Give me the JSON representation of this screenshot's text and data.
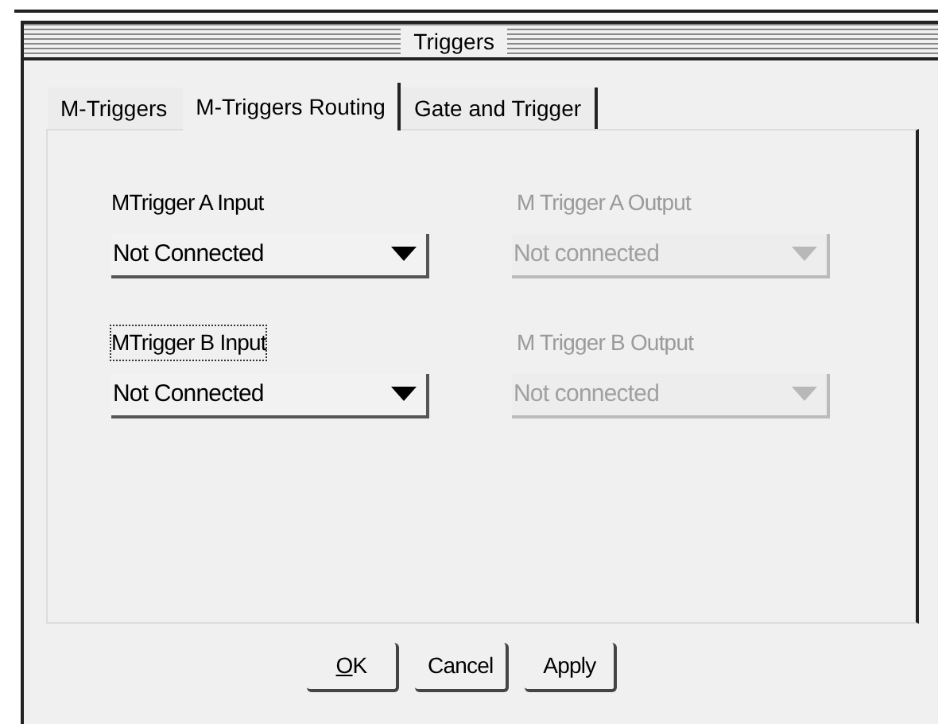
{
  "window": {
    "title": "Triggers"
  },
  "tabs": [
    {
      "label": "M-Triggers",
      "selected": false
    },
    {
      "label": "M-Triggers Routing",
      "selected": true
    },
    {
      "label": "Gate and Trigger",
      "selected": false
    }
  ],
  "rows": [
    {
      "fields": [
        {
          "label": "MTrigger A Input",
          "value": "Not Connected",
          "disabled": false,
          "focused": false
        },
        {
          "label": "M Trigger A Output",
          "value": "Not connected",
          "disabled": true,
          "focused": false
        }
      ]
    },
    {
      "fields": [
        {
          "label": "MTrigger B Input",
          "value": "Not Connected",
          "disabled": false,
          "focused": true
        },
        {
          "label": "M Trigger B Output",
          "value": "Not connected",
          "disabled": true,
          "focused": false
        }
      ]
    }
  ],
  "buttons": [
    {
      "label": "OK",
      "underline_first": true
    },
    {
      "label": "Cancel",
      "underline_first": false
    },
    {
      "label": "Apply",
      "underline_first": false
    }
  ]
}
